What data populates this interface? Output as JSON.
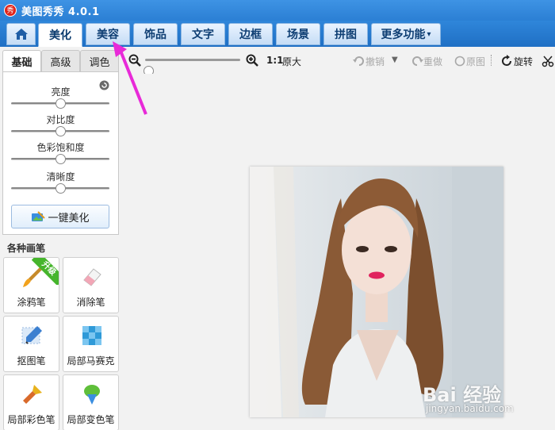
{
  "app": {
    "title": "美图秀秀 4.0.1",
    "logo_text": "秀"
  },
  "nav": {
    "tabs": [
      {
        "label": "美化"
      },
      {
        "label": "美容"
      },
      {
        "label": "饰品"
      },
      {
        "label": "文字"
      },
      {
        "label": "边框"
      },
      {
        "label": "场景"
      },
      {
        "label": "拼图"
      },
      {
        "label": "更多功能"
      }
    ],
    "more_caret": "▾",
    "active_index": 0
  },
  "toolbar": {
    "zoom_level": 0,
    "actual_size_label": "1:1",
    "actual_size_text": "原大",
    "undo_label": "撤销",
    "redo_label": "重做",
    "original_label": "原图",
    "rotate_label": "旋转"
  },
  "left_panel": {
    "sub_tabs": [
      "基础",
      "高级",
      "调色"
    ],
    "sliders": [
      {
        "label": "亮度",
        "value": 0.5
      },
      {
        "label": "对比度",
        "value": 0.5
      },
      {
        "label": "色彩饱和度",
        "value": 0.5
      },
      {
        "label": "清晰度",
        "value": 0.5
      }
    ],
    "one_click_label": "一键美化",
    "brush_heading": "各种画笔",
    "brushes": [
      {
        "label": "涂鸦笔",
        "icon": "paintbrush-icon",
        "badge": "升级"
      },
      {
        "label": "消除笔",
        "icon": "eraser-icon"
      },
      {
        "label": "抠图笔",
        "icon": "cutout-pen-icon"
      },
      {
        "label": "局部马赛克",
        "icon": "mosaic-icon"
      },
      {
        "label": "局部彩色笔",
        "icon": "color-brush-icon"
      },
      {
        "label": "局部变色笔",
        "icon": "recolor-brush-icon"
      }
    ]
  },
  "watermark": {
    "main": "Bai 经验",
    "sub": "jingyan.baidu.com"
  },
  "colors": {
    "nav_blue": "#2b7fd4",
    "annotation": "#e82ad8",
    "upgrade_green": "#46b52c"
  }
}
